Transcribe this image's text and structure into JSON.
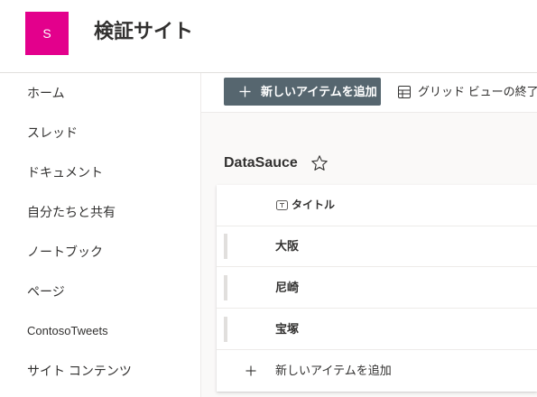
{
  "site": {
    "logo_letter": "S",
    "title": "検証サイト"
  },
  "nav": {
    "items": [
      {
        "label": "ホーム"
      },
      {
        "label": "スレッド"
      },
      {
        "label": "ドキュメント"
      },
      {
        "label": "自分たちと共有"
      },
      {
        "label": "ノートブック"
      },
      {
        "label": "ページ"
      },
      {
        "label": "ContosoTweets"
      },
      {
        "label": "サイト コンテンツ"
      }
    ]
  },
  "command_bar": {
    "new_item_label": "新しいアイテムを追加",
    "new_item_icon": "plus-icon",
    "exit_grid_label": "グリッド ビューの終了",
    "exit_grid_icon": "grid-icon"
  },
  "list": {
    "title": "DataSauce",
    "favorite_icon": "star-outline-icon",
    "column_header": "タイトル",
    "column_icon": "text-column-icon",
    "rows": [
      "大阪",
      "尼崎",
      "宝塚"
    ],
    "add_item_label": "新しいアイテムを追加"
  },
  "colors": {
    "logo_bg": "#e3008c",
    "primary_button_bg": "#56666f",
    "text": "#323130",
    "divider": "#edebe9",
    "content_bg": "#faf9f8"
  }
}
